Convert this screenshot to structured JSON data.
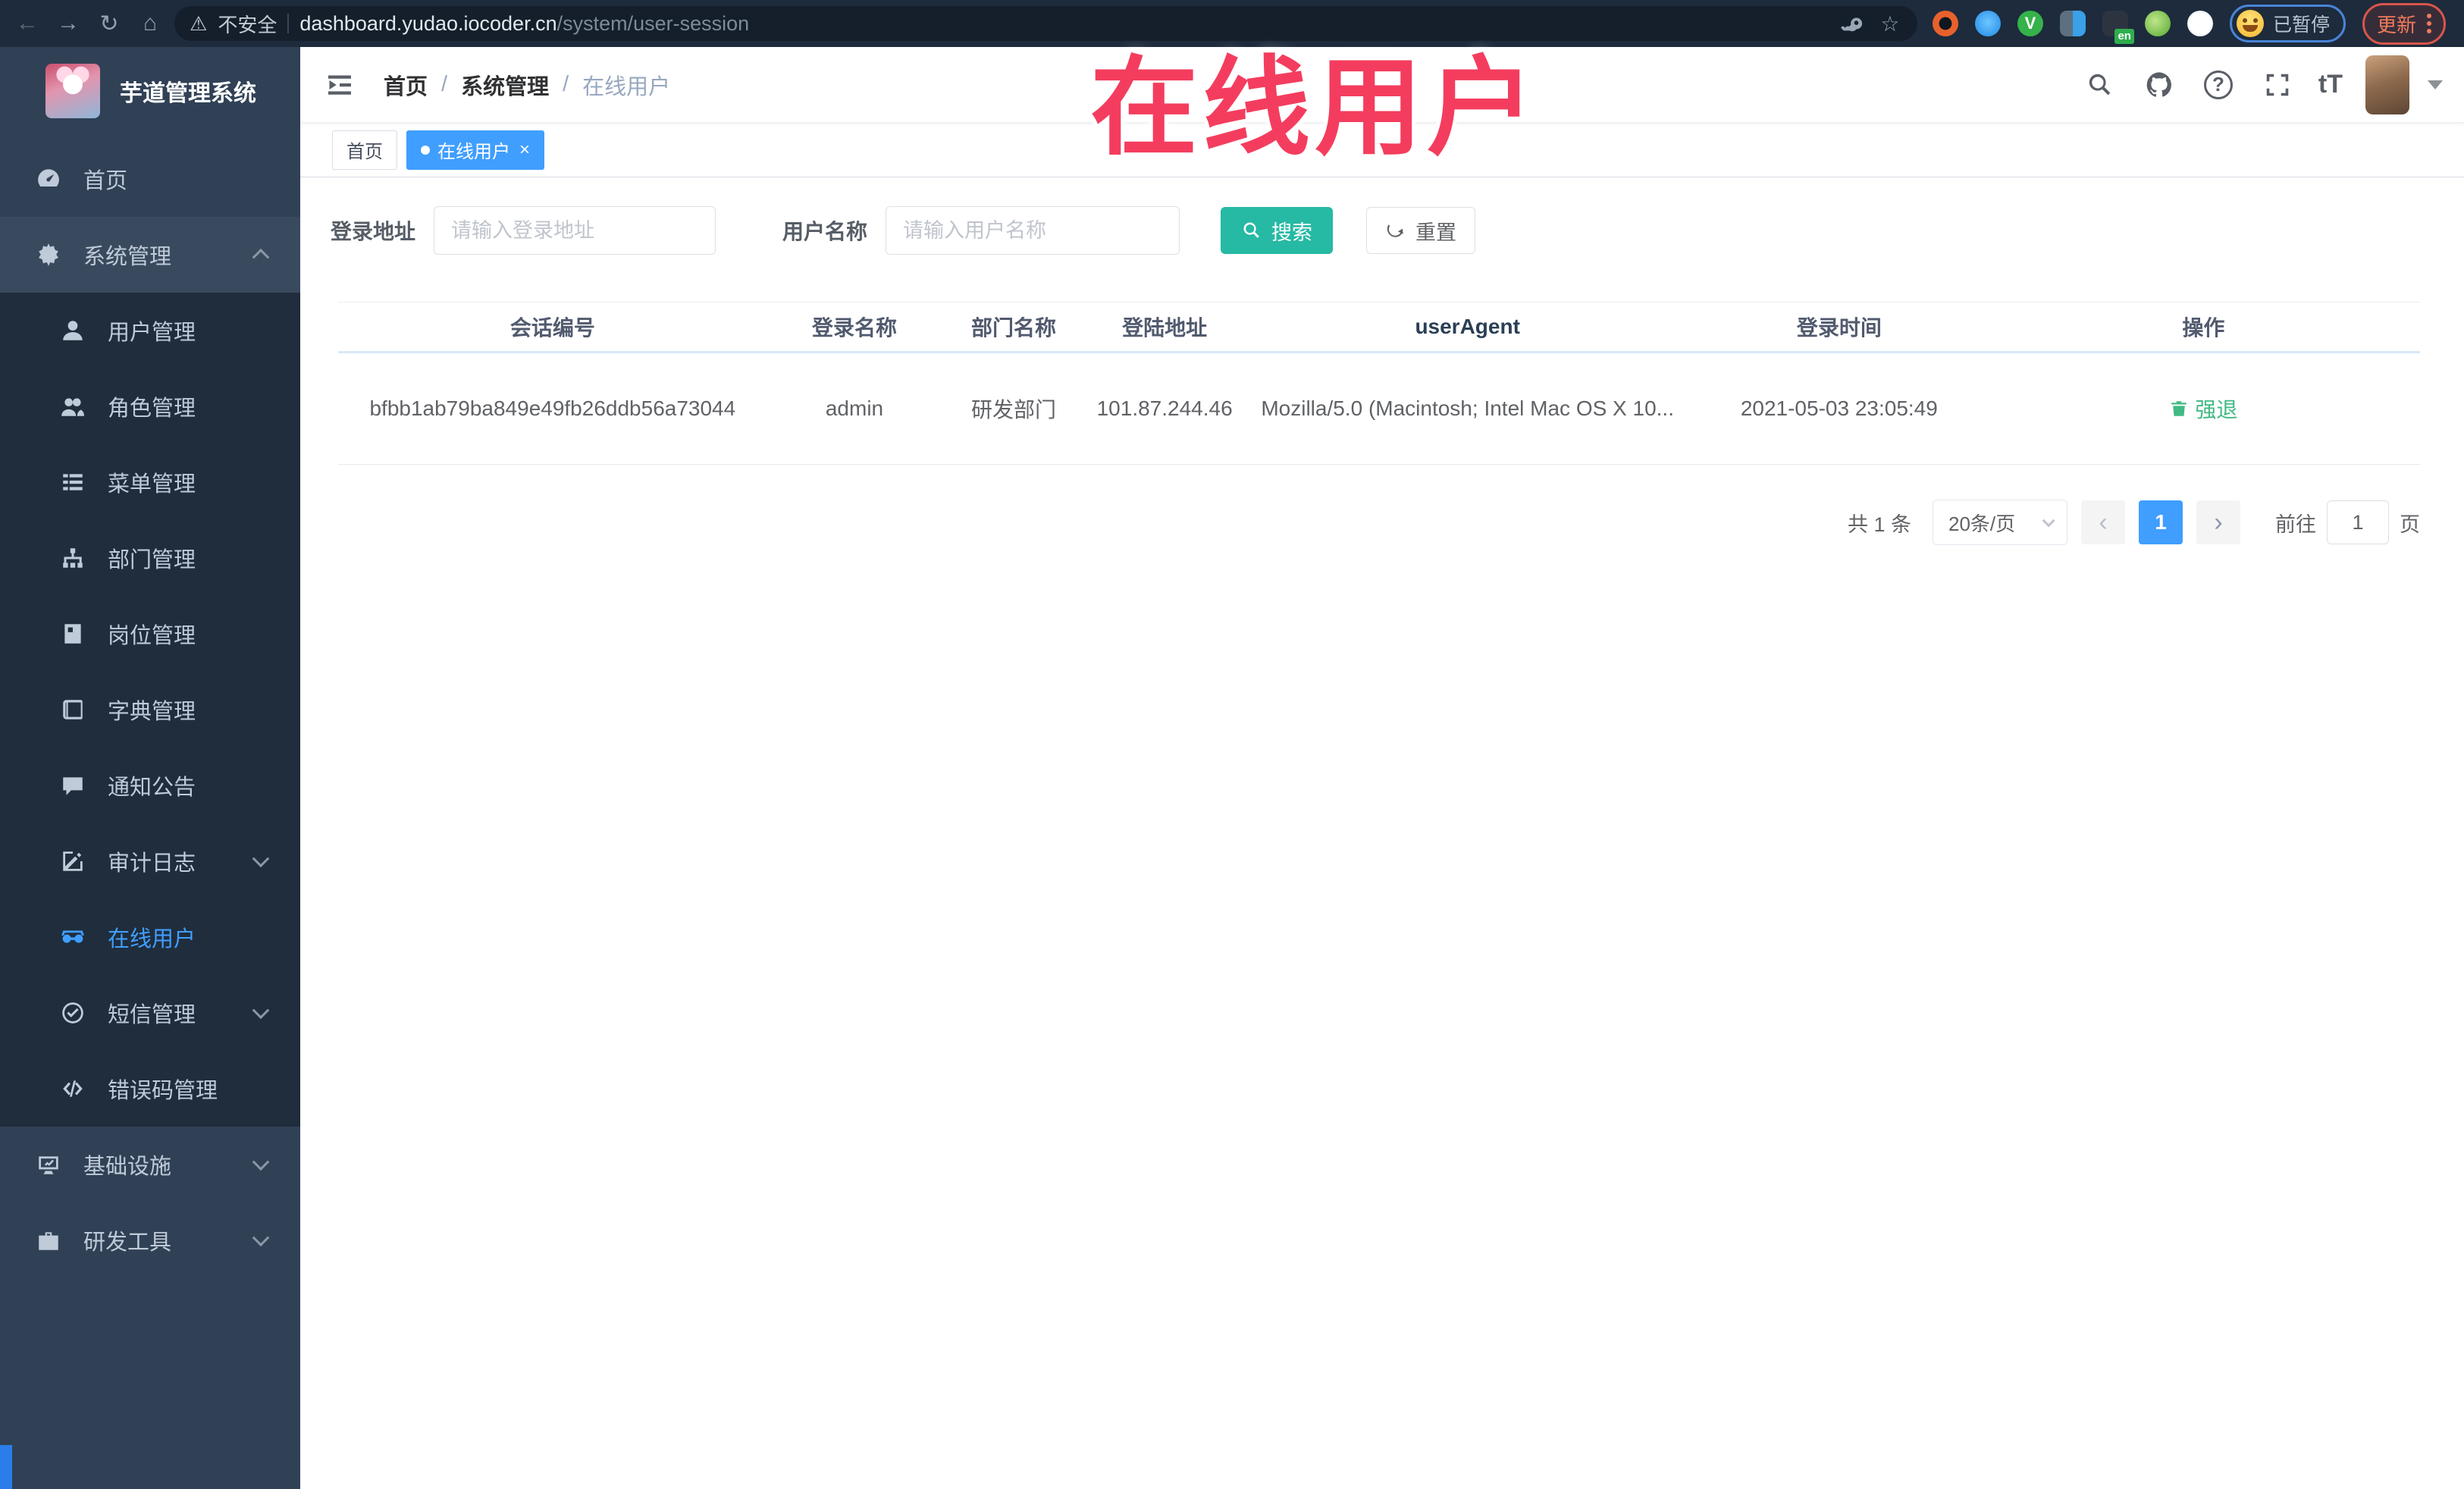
{
  "colors": {
    "accent": "#409eff",
    "search_button": "#26b9a4",
    "action_link": "#42b983",
    "annotation": "#f43d5e",
    "sidebar_bg": "#304156",
    "submenu_bg": "#1f2d3d",
    "browser_bg": "#1d2b3c"
  },
  "annotation": {
    "text": "在线用户"
  },
  "browser": {
    "security_label": "不安全",
    "url_host": "dashboard.yudao.iocoder.cn",
    "url_path": "/system/user-session",
    "extension_badge": "en",
    "paused_label": "已暂停",
    "update_label": "更新"
  },
  "sidebar": {
    "logo_title": "芋道管理系统",
    "items": [
      {
        "label": "首页"
      },
      {
        "label": "系统管理"
      },
      {
        "label": "用户管理"
      },
      {
        "label": "角色管理"
      },
      {
        "label": "菜单管理"
      },
      {
        "label": "部门管理"
      },
      {
        "label": "岗位管理"
      },
      {
        "label": "字典管理"
      },
      {
        "label": "通知公告"
      },
      {
        "label": "审计日志"
      },
      {
        "label": "在线用户"
      },
      {
        "label": "短信管理"
      },
      {
        "label": "错误码管理"
      },
      {
        "label": "基础设施"
      },
      {
        "label": "研发工具"
      }
    ]
  },
  "header": {
    "breadcrumb": [
      "首页",
      "系统管理",
      "在线用户"
    ],
    "breadcrumb_sep": "/",
    "text_size_label": "tT"
  },
  "tags": [
    {
      "label": "首页"
    },
    {
      "label": "在线用户",
      "close": "×"
    }
  ],
  "search": {
    "addr_label": "登录地址",
    "addr_placeholder": "请输入登录地址",
    "name_label": "用户名称",
    "name_placeholder": "请输入用户名称",
    "search_btn": "搜索",
    "reset_btn": "重置"
  },
  "table": {
    "headers": [
      "会话编号",
      "登录名称",
      "部门名称",
      "登陆地址",
      "userAgent",
      "登录时间",
      "操作"
    ],
    "rows": [
      {
        "session_id": "bfbb1ab79ba849e49fb26ddb56a73044",
        "login_name": "admin",
        "dept_name": "研发部门",
        "login_addr": "101.87.244.46",
        "user_agent": "Mozilla/5.0 (Macintosh; Intel Mac OS X 10...",
        "login_time": "2021-05-03 23:05:49",
        "action": "强退"
      }
    ]
  },
  "pagination": {
    "total_text": "共 1 条",
    "page_size": "20条/页",
    "current_page": "1",
    "prev": "‹",
    "next": "›",
    "goto_label": "前往",
    "goto_value": "1",
    "page_suffix": "页"
  }
}
